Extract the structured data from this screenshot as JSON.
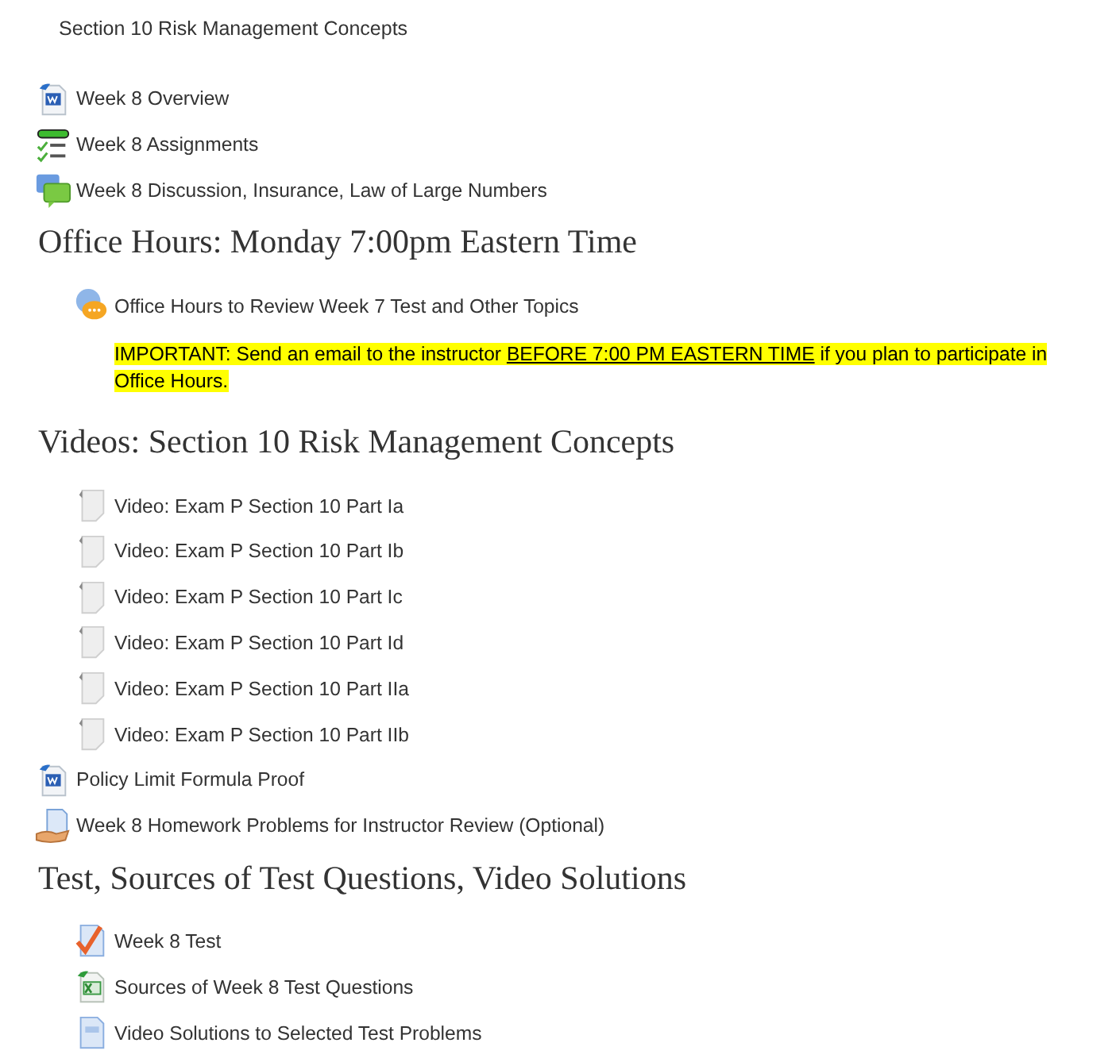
{
  "blocks": [
    {
      "kind": "summary",
      "text": "Section 10 Risk Management Concepts"
    },
    {
      "kind": "word",
      "label": "Week 8 Overview"
    },
    {
      "kind": "assignment",
      "label": "Week 8 Assignments"
    },
    {
      "kind": "forum",
      "label": "Week 8 Discussion, Insurance, Law of Large Numbers"
    },
    {
      "kind": "heading",
      "text": "Office Hours: Monday 7:00pm Eastern Time"
    },
    {
      "kind": "group",
      "children": [
        {
          "kind": "chat",
          "label": "Office Hours to Review Week 7 Test and Other Topics"
        },
        {
          "kind": "notice",
          "parts": [
            {
              "text": "IMPORTANT: Send an email to the instructor ",
              "underline": false
            },
            {
              "text": "BEFORE 7:00 PM EASTERN TIME",
              "underline": true
            },
            {
              "text": " if you plan to participate in Office Hours.",
              "underline": false
            }
          ]
        }
      ]
    },
    {
      "kind": "heading",
      "text": "Videos: Section 10 Risk Management Concepts"
    },
    {
      "kind": "group",
      "children": [
        {
          "kind": "file",
          "label": "Video: Exam P Section 10 Part Ia"
        },
        {
          "kind": "file",
          "label": "Video: Exam P Section 10 Part Ib"
        },
        {
          "kind": "file",
          "label": "Video: Exam P Section 10 Part Ic"
        },
        {
          "kind": "file",
          "label": "Video: Exam P Section 10 Part Id"
        },
        {
          "kind": "file",
          "label": "Video: Exam P Section 10 Part IIa"
        },
        {
          "kind": "file",
          "label": "Video: Exam P Section 10 Part IIb"
        }
      ]
    },
    {
      "kind": "word",
      "label": "Policy Limit Formula Proof"
    },
    {
      "kind": "homework",
      "label": "Week 8 Homework Problems for Instructor Review (Optional)"
    },
    {
      "kind": "heading",
      "text": "Test, Sources of Test Questions, Video Solutions"
    },
    {
      "kind": "group",
      "children": [
        {
          "kind": "quiz",
          "label": "Week 8 Test"
        },
        {
          "kind": "excel",
          "label": "Sources of Week 8 Test Questions"
        },
        {
          "kind": "page",
          "label": "Video Solutions to Selected Test Problems"
        }
      ]
    }
  ]
}
